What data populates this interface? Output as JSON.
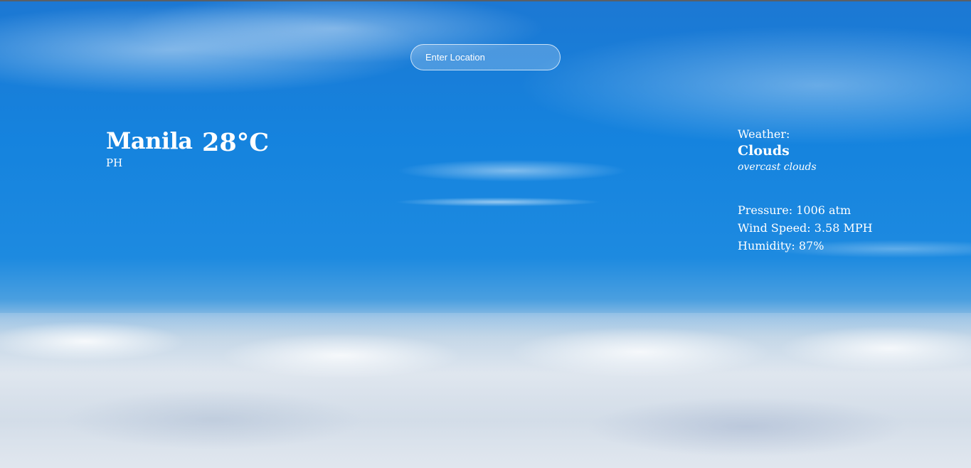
{
  "search": {
    "placeholder": "Enter Location"
  },
  "location": {
    "city": "Manila",
    "country": "PH"
  },
  "temperature": "28°C",
  "weather": {
    "label": "Weather:",
    "main": "Clouds",
    "description": "overcast clouds"
  },
  "stats": {
    "pressure": "Pressure: 1006 atm",
    "wind": "Wind Speed: 3.58 MPH",
    "humidity": "Humidity: 87%"
  },
  "colors": {
    "sky": "#1583de",
    "text": "#ffffff"
  }
}
